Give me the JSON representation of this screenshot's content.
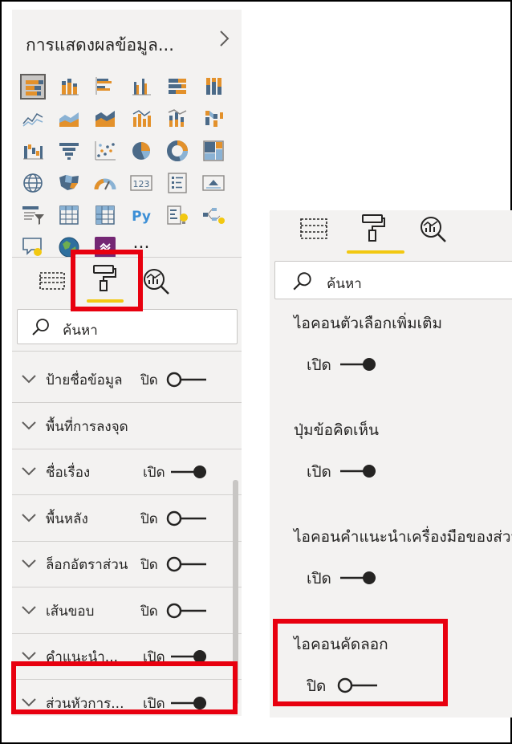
{
  "left_pane": {
    "title": "การแสดงผลข้อมูล...",
    "chevron_icon": "chevron-right-icon",
    "more_visuals": "...",
    "visuals": [
      "stacked-bar-icon",
      "stacked-column-icon",
      "clustered-bar-icon",
      "clustered-column-icon",
      "100-stacked-bar-icon",
      "100-stacked-column-icon",
      "line-chart-icon",
      "area-chart-icon",
      "stacked-area-icon",
      "line-clustered-column-icon",
      "line-stacked-column-icon",
      "ribbon-chart-icon",
      "waterfall-icon",
      "funnel-icon",
      "scatter-icon",
      "pie-icon",
      "donut-icon",
      "treemap-icon",
      "map-icon",
      "filled-map-icon",
      "gauge-icon",
      "card-icon",
      "multi-row-card-icon",
      "kpi-icon",
      "slicer-icon",
      "table-icon",
      "matrix-icon",
      "python-visual-icon",
      "key-influencers-icon",
      "decomposition-tree-icon",
      "qa-icon",
      "arcgis-map-icon",
      "powerapps-icon"
    ],
    "card_text": "123",
    "python_text": "Py",
    "search_placeholder": "ค้นหา",
    "rows": [
      {
        "label": "ป้ายชื่อข้อมูล",
        "state": "ปิด",
        "on": false
      },
      {
        "label": "พื้นที่การลงจุด",
        "state": "",
        "on": null
      },
      {
        "label": "ชื่อเรื่อง",
        "state": "เปิด",
        "on": true
      },
      {
        "label": "พื้นหลัง",
        "state": "ปิด",
        "on": false
      },
      {
        "label": "ล็อกอัตราส่วน",
        "state": "ปิด",
        "on": false
      },
      {
        "label": "เส้นขอบ",
        "state": "ปิด",
        "on": false
      },
      {
        "label": "คำแนะนำ...",
        "state": "เปิด",
        "on": true
      },
      {
        "label": "ส่วนหัวการ...",
        "state": "เปิด",
        "on": true
      }
    ]
  },
  "right_pane": {
    "search_placeholder": "ค้นหา",
    "settings": [
      {
        "label": "ไอคอนตัวเลือกเพิ่มเติม",
        "state": "เปิด",
        "on": true
      },
      {
        "label": "ปุ่มข้อคิดเห็น",
        "state": "เปิด",
        "on": true
      },
      {
        "label": "ไอคอนคำแนะนำเครื่องมือของส่วนหัว",
        "state": "เปิด",
        "on": true
      },
      {
        "label": "ไอคอนคัดลอก",
        "state": "ปิด",
        "on": false
      }
    ]
  },
  "colors": {
    "highlight": "#e8000f",
    "active_tab_underline": "#f2c811",
    "pane_background": "#f3f2f1",
    "toggle": "#252423"
  },
  "tabs": [
    "fields-icon",
    "format-paint-roller-icon",
    "analytics-magnifier-icon"
  ]
}
